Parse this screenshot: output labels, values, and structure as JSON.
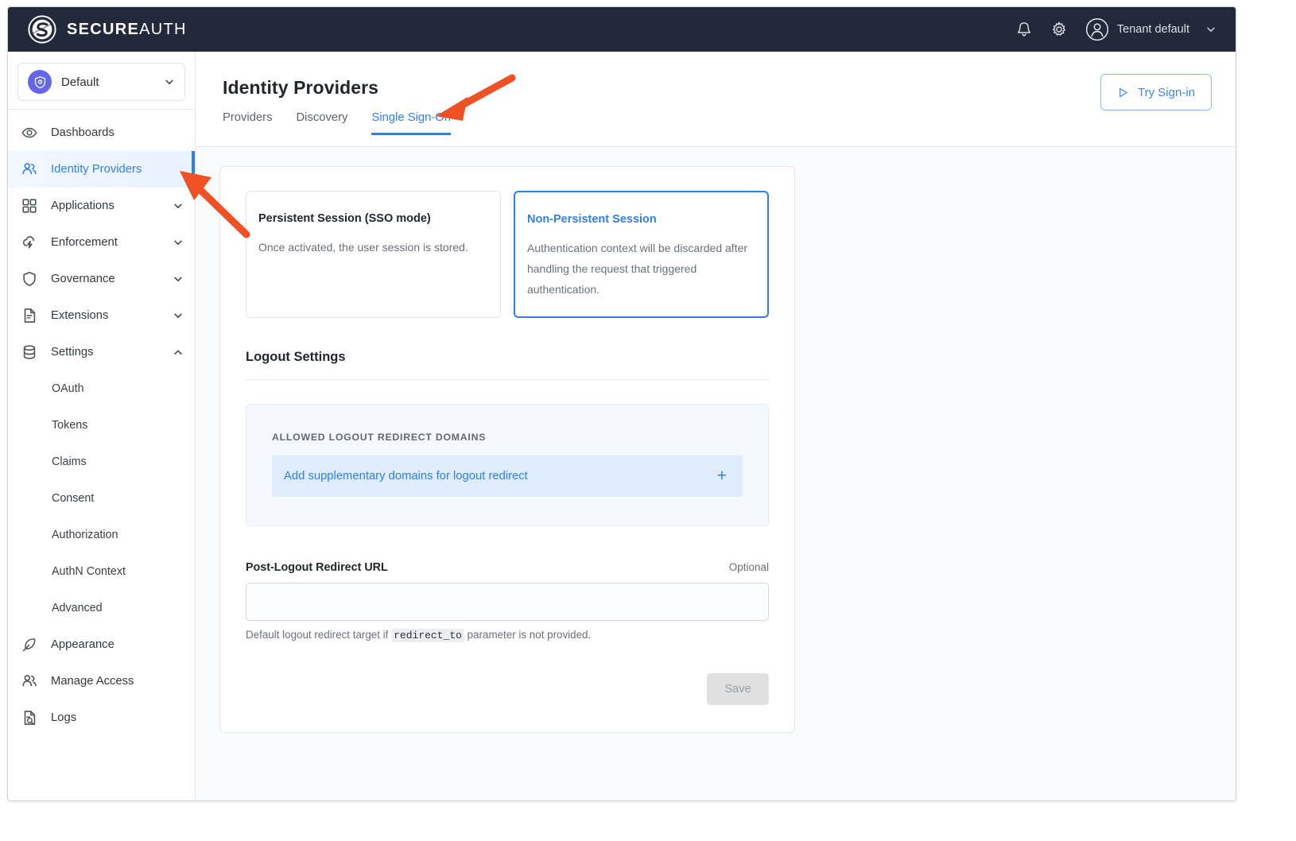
{
  "topbar": {
    "brand_bold": "SECURE",
    "brand_light": "AUTH",
    "notifications_icon": "bell-icon",
    "settings_icon": "gear-icon",
    "avatar_icon": "user-avatar-icon",
    "tenant_label": "Tenant default",
    "tenant_caret_icon": "chevron-down-icon"
  },
  "sidebar": {
    "tenant_selector": {
      "name": "Default",
      "badge_icon": "shield-icon",
      "caret_icon": "chevron-down-icon"
    },
    "items": [
      {
        "label": "Dashboards",
        "icon": "eye-icon",
        "expandable": false,
        "active": false
      },
      {
        "label": "Identity Providers",
        "icon": "users-icon",
        "expandable": false,
        "active": true
      },
      {
        "label": "Applications",
        "icon": "grid-icon",
        "expandable": true,
        "active": false
      },
      {
        "label": "Enforcement",
        "icon": "cloud-bolt-icon",
        "expandable": true,
        "active": false
      },
      {
        "label": "Governance",
        "icon": "shield-icon",
        "expandable": true,
        "active": false
      },
      {
        "label": "Extensions",
        "icon": "document-icon",
        "expandable": true,
        "active": false
      },
      {
        "label": "Settings",
        "icon": "database-icon",
        "expandable": true,
        "active": false,
        "expanded": true
      }
    ],
    "settings_children": [
      {
        "label": "OAuth"
      },
      {
        "label": "Tokens"
      },
      {
        "label": "Claims"
      },
      {
        "label": "Consent"
      },
      {
        "label": "Authorization"
      },
      {
        "label": "AuthN Context"
      },
      {
        "label": "Advanced"
      }
    ],
    "items_after": [
      {
        "label": "Appearance",
        "icon": "feather-icon"
      },
      {
        "label": "Manage Access",
        "icon": "users-icon"
      },
      {
        "label": "Logs",
        "icon": "document-search-icon"
      }
    ]
  },
  "page": {
    "title": "Identity Providers",
    "tabs": [
      {
        "label": "Providers",
        "active": false
      },
      {
        "label": "Discovery",
        "active": false
      },
      {
        "label": "Single Sign-On",
        "active": true
      }
    ],
    "try_signin": {
      "label": "Try Sign-in",
      "icon": "play-triangle-icon"
    }
  },
  "session_modes": [
    {
      "title": "Persistent Session (SSO mode)",
      "description": "Once activated, the user session is stored.",
      "selected": false
    },
    {
      "title": "Non-Persistent Session",
      "description": "Authentication context will be discarded after handling the request that triggered authentication.",
      "selected": true
    }
  ],
  "logout_settings": {
    "heading": "Logout Settings",
    "allowed_domains_label": "ALLOWED LOGOUT REDIRECT DOMAINS",
    "add_domains_label": "Add supplementary domains for logout redirect",
    "add_icon": "plus-icon",
    "post_logout": {
      "label": "Post-Logout Redirect URL",
      "optional_label": "Optional",
      "value": "",
      "placeholder": "",
      "hint_before": "Default logout redirect target if ",
      "hint_code": "redirect_to",
      "hint_after": " parameter is not provided."
    },
    "save_label": "Save"
  },
  "annotations": {
    "arrow_color": "#ef5125",
    "arrow_to_tab": "points to Single Sign-On tab",
    "arrow_to_sidebar": "points to Identity Providers nav item"
  },
  "colors": {
    "topbar_bg": "#22293a",
    "accent_blue": "#2f80ed",
    "tenant_badge": "#6366e8",
    "arrow_orange": "#ef5125"
  }
}
